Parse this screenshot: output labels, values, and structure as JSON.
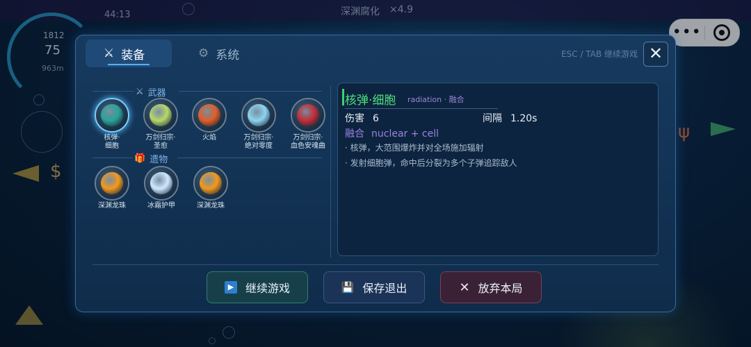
{
  "hud": {
    "status_title": "深渊腐化",
    "multiplier": "×4.9",
    "timer": "44:13",
    "hp": "1812",
    "score": "75",
    "depth": "963m"
  },
  "tabs": [
    {
      "label": "装备",
      "icon": "crossed-swords-icon",
      "active": true
    },
    {
      "label": "系统",
      "icon": "gear-icon",
      "active": false
    }
  ],
  "esc_hint": "ESC / TAB 继续游戏",
  "close_label": "✕",
  "sections": {
    "weapons": {
      "title": "武器",
      "icon": "crossed-swords-icon"
    },
    "relics": {
      "title": "遗物",
      "icon": "gift-icon"
    }
  },
  "weapons": [
    {
      "name": "核弹·\n细胞",
      "color": "#2aa59a",
      "selected": true
    },
    {
      "name": "万剑归宗·\n圣愈",
      "color": "#b8d86a",
      "selected": false
    },
    {
      "name": "火焰",
      "color": "#e0602a",
      "selected": false
    },
    {
      "name": "万剑归宗·\n绝对零度",
      "color": "#8fd4f0",
      "selected": false
    },
    {
      "name": "万剑归宗·\n血色安魂曲",
      "color": "#c0303a",
      "selected": false
    }
  ],
  "relics": [
    {
      "name": "深渊龙珠",
      "color": "#f39a1f"
    },
    {
      "name": "冰霜护甲",
      "color": "#cfe9ff"
    },
    {
      "name": "深渊龙珠",
      "color": "#f39a1f"
    }
  ],
  "detail": {
    "title": "核弹·细胞",
    "tag": "radiation · 融合",
    "damage_label": "伤害",
    "damage_value": "6",
    "interval_label": "间隔",
    "interval_value": "1.20s",
    "fusion_label": "融合",
    "fusion_value": "nuclear + cell",
    "lines": [
      "· 核弹，大范围爆炸并对全场施加辐射",
      "· 发射细胞弹，命中后分裂为多个子弹追踪敌人"
    ]
  },
  "buttons": {
    "continue": {
      "label": "继续游戏",
      "icon": "play-icon"
    },
    "save": {
      "label": "保存退出",
      "icon": "save-icon"
    },
    "quit": {
      "label": "放弃本局",
      "icon": "close-icon"
    }
  },
  "colors": {
    "accent": "#5ab0f0",
    "title_green": "#4ee07a",
    "fusion_purple": "#9c82e0"
  }
}
